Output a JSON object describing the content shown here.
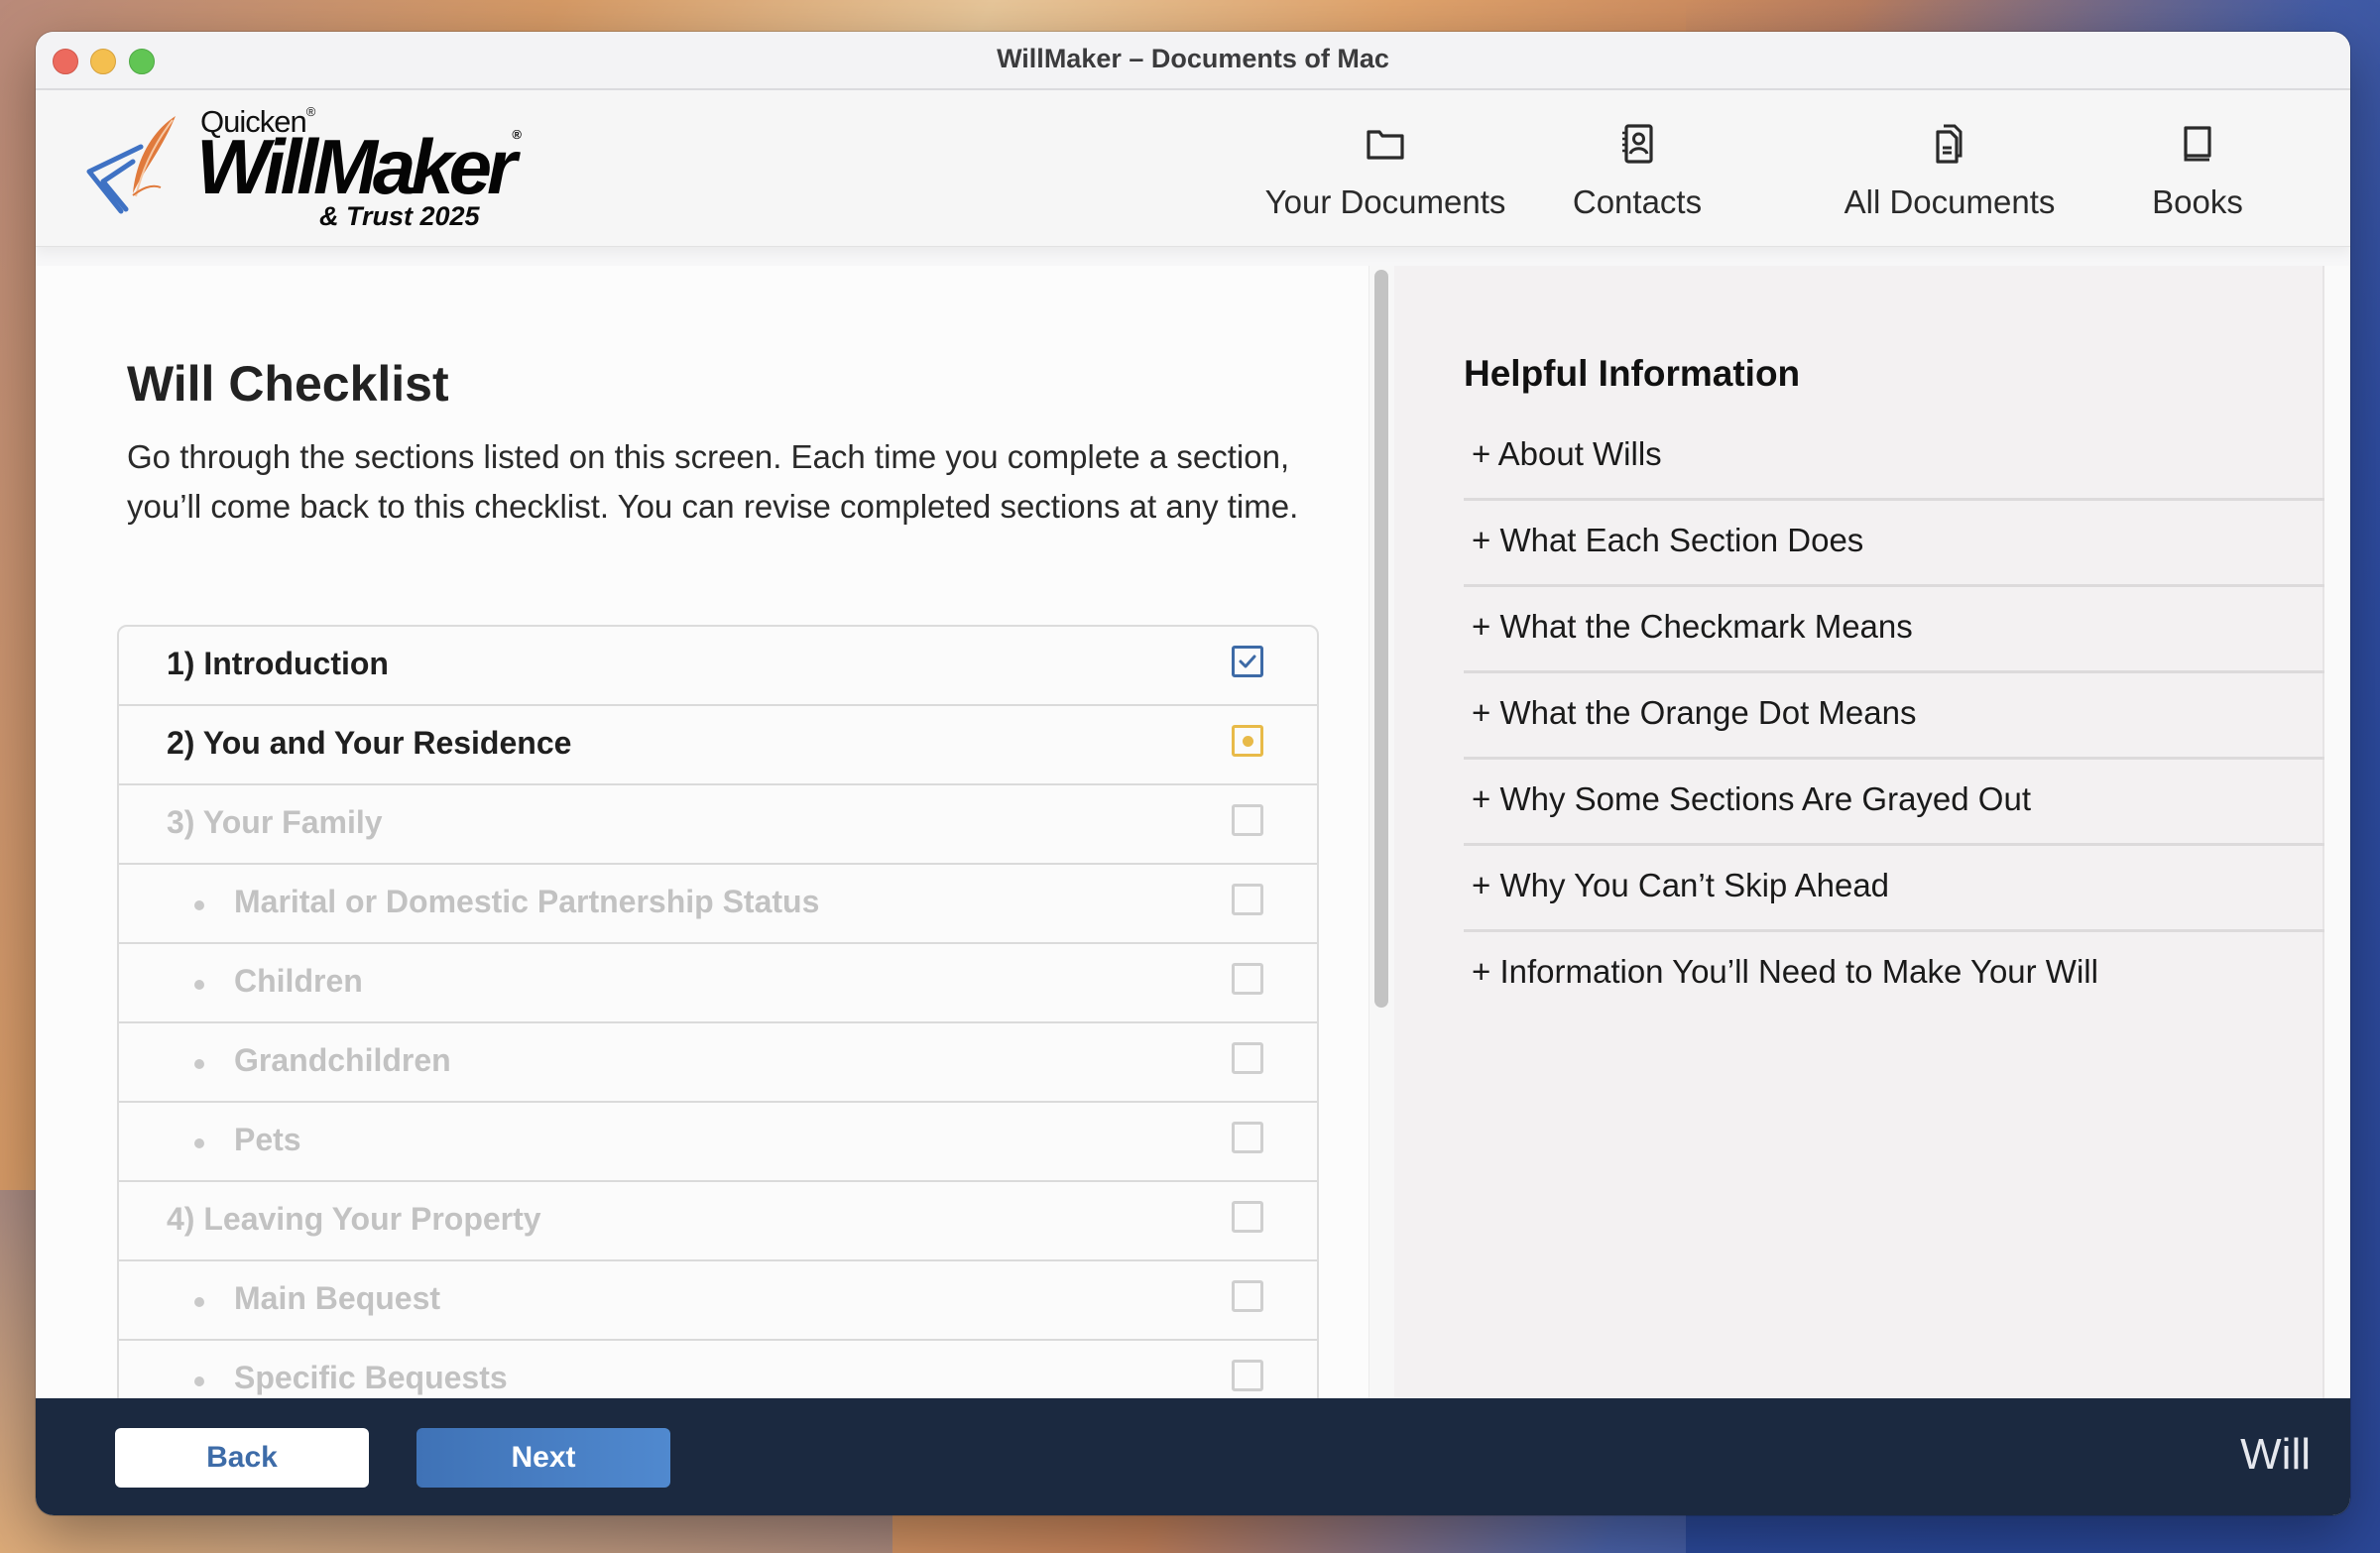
{
  "window": {
    "title": "WillMaker – Documents of Mac"
  },
  "logo": {
    "brand": "Quicken",
    "product": "WillMaker",
    "edition": "& Trust 2025",
    "registered_mark": "®"
  },
  "nav": {
    "items": [
      {
        "label": "Your Documents",
        "icon": "folder-icon"
      },
      {
        "label": "Contacts",
        "icon": "contacts-book-icon"
      },
      {
        "label": "All Documents",
        "icon": "documents-stack-icon"
      },
      {
        "label": "Books",
        "icon": "book-icon"
      }
    ]
  },
  "main": {
    "title": "Will Checklist",
    "intro": "Go through the sections listed on this screen. Each time you complete a section, you’ll come back to this checklist. You can revise completed sections at any time.",
    "checklist": [
      {
        "label": "1) Introduction",
        "level": "section",
        "status": "complete",
        "enabled": true
      },
      {
        "label": "2) You and Your Residence",
        "level": "section",
        "status": "in-progress",
        "enabled": true
      },
      {
        "label": "3) Your Family",
        "level": "section",
        "status": "not-started",
        "enabled": false
      },
      {
        "label": "Marital or Domestic Partnership Status",
        "level": "subsection",
        "status": "not-started",
        "enabled": false
      },
      {
        "label": "Children",
        "level": "subsection",
        "status": "not-started",
        "enabled": false
      },
      {
        "label": "Grandchildren",
        "level": "subsection",
        "status": "not-started",
        "enabled": false
      },
      {
        "label": "Pets",
        "level": "subsection",
        "status": "not-started",
        "enabled": false
      },
      {
        "label": "4) Leaving Your Property",
        "level": "section",
        "status": "not-started",
        "enabled": false
      },
      {
        "label": "Main Bequest",
        "level": "subsection",
        "status": "not-started",
        "enabled": false
      },
      {
        "label": "Specific Bequests",
        "level": "subsection",
        "status": "not-started",
        "enabled": false
      }
    ]
  },
  "help": {
    "title": "Helpful Information",
    "items": [
      "+ About Wills",
      "+ What Each Section Does",
      "+ What the Checkmark Means",
      "+ What the Orange Dot Means",
      "+ Why Some Sections Are Grayed Out",
      "+ Why You Can’t Skip Ahead",
      "+ Information You’ll Need to Make Your Will"
    ]
  },
  "footer": {
    "back_label": "Back",
    "next_label": "Next",
    "document_type": "Will"
  },
  "colors": {
    "complete": "#3d6aa6",
    "in_progress": "#e8ba48",
    "footer_bg": "#1b2940",
    "primary_button": "#4a82c8"
  }
}
